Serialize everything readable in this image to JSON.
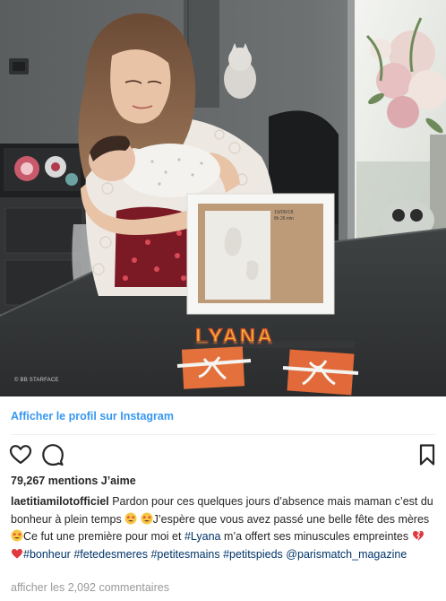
{
  "photo": {
    "alt_kind": "photo",
    "watermark": "© BB STARFACE",
    "name_letters": "LYANA",
    "frame_date_text": "19/05/18",
    "frame_time_text": "8h 26 min"
  },
  "profile_link": "Afficher le profil sur Instagram",
  "actions": {
    "like_icon": "heart-outline-icon",
    "comment_icon": "speech-bubble-icon",
    "save_icon": "bookmark-icon"
  },
  "likes_text": "79,267 mentions J’aime",
  "caption": {
    "username": "laetitiamilotofficiel",
    "part1": " Pardon pour ces quelques jours d’absence mais maman c’est du bonheur à plein temps ",
    "part2": "J’espère que vous avez passé une belle fête des mères",
    "part3": "Ce fut une première pour moi et ",
    "tag_lyana": "#Lyana",
    "part4": " m’a offert ses minuscules empreintes ",
    "tag_bonheur": "#bonheur",
    "tag_fete": "#fetedesmeres",
    "tag_mains": "#petitesmains",
    "tag_pieds": "#petitspieds",
    "mention": "@parismatch_magazine"
  },
  "comments_link": "afficher les 2,092 commentaires",
  "colors": {
    "link_blue": "#3897f0",
    "hashtag_blue": "#003569",
    "muted_gray": "#999999",
    "text": "#262626"
  }
}
